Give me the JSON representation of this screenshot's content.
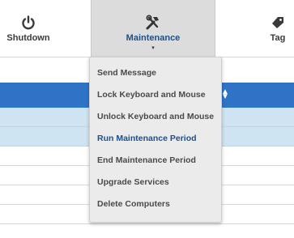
{
  "toolbar": {
    "shutdown": {
      "label": "Shutdown",
      "icon": "power-icon"
    },
    "maintenance": {
      "label": "Maintenance",
      "icon": "tools-icon",
      "caret": "▾"
    },
    "tag": {
      "label": "Tag",
      "icon": "tag-icon"
    }
  },
  "menu": {
    "items": [
      {
        "label": "Send Message",
        "active": false
      },
      {
        "label": "Lock Keyboard and Mouse",
        "active": false
      },
      {
        "label": "Unlock Keyboard and Mouse",
        "active": false
      },
      {
        "label": "Run Maintenance Period",
        "active": true
      },
      {
        "label": "End Maintenance Period",
        "active": false
      },
      {
        "label": "Upgrade Services",
        "active": false
      },
      {
        "label": "Delete Computers",
        "active": false
      }
    ]
  },
  "grid": {
    "sort_indicator": "▲▼"
  },
  "colors": {
    "header": "#2f73c6",
    "selected_row": "#cfe4f2",
    "accent_text": "#1b4f8f"
  }
}
